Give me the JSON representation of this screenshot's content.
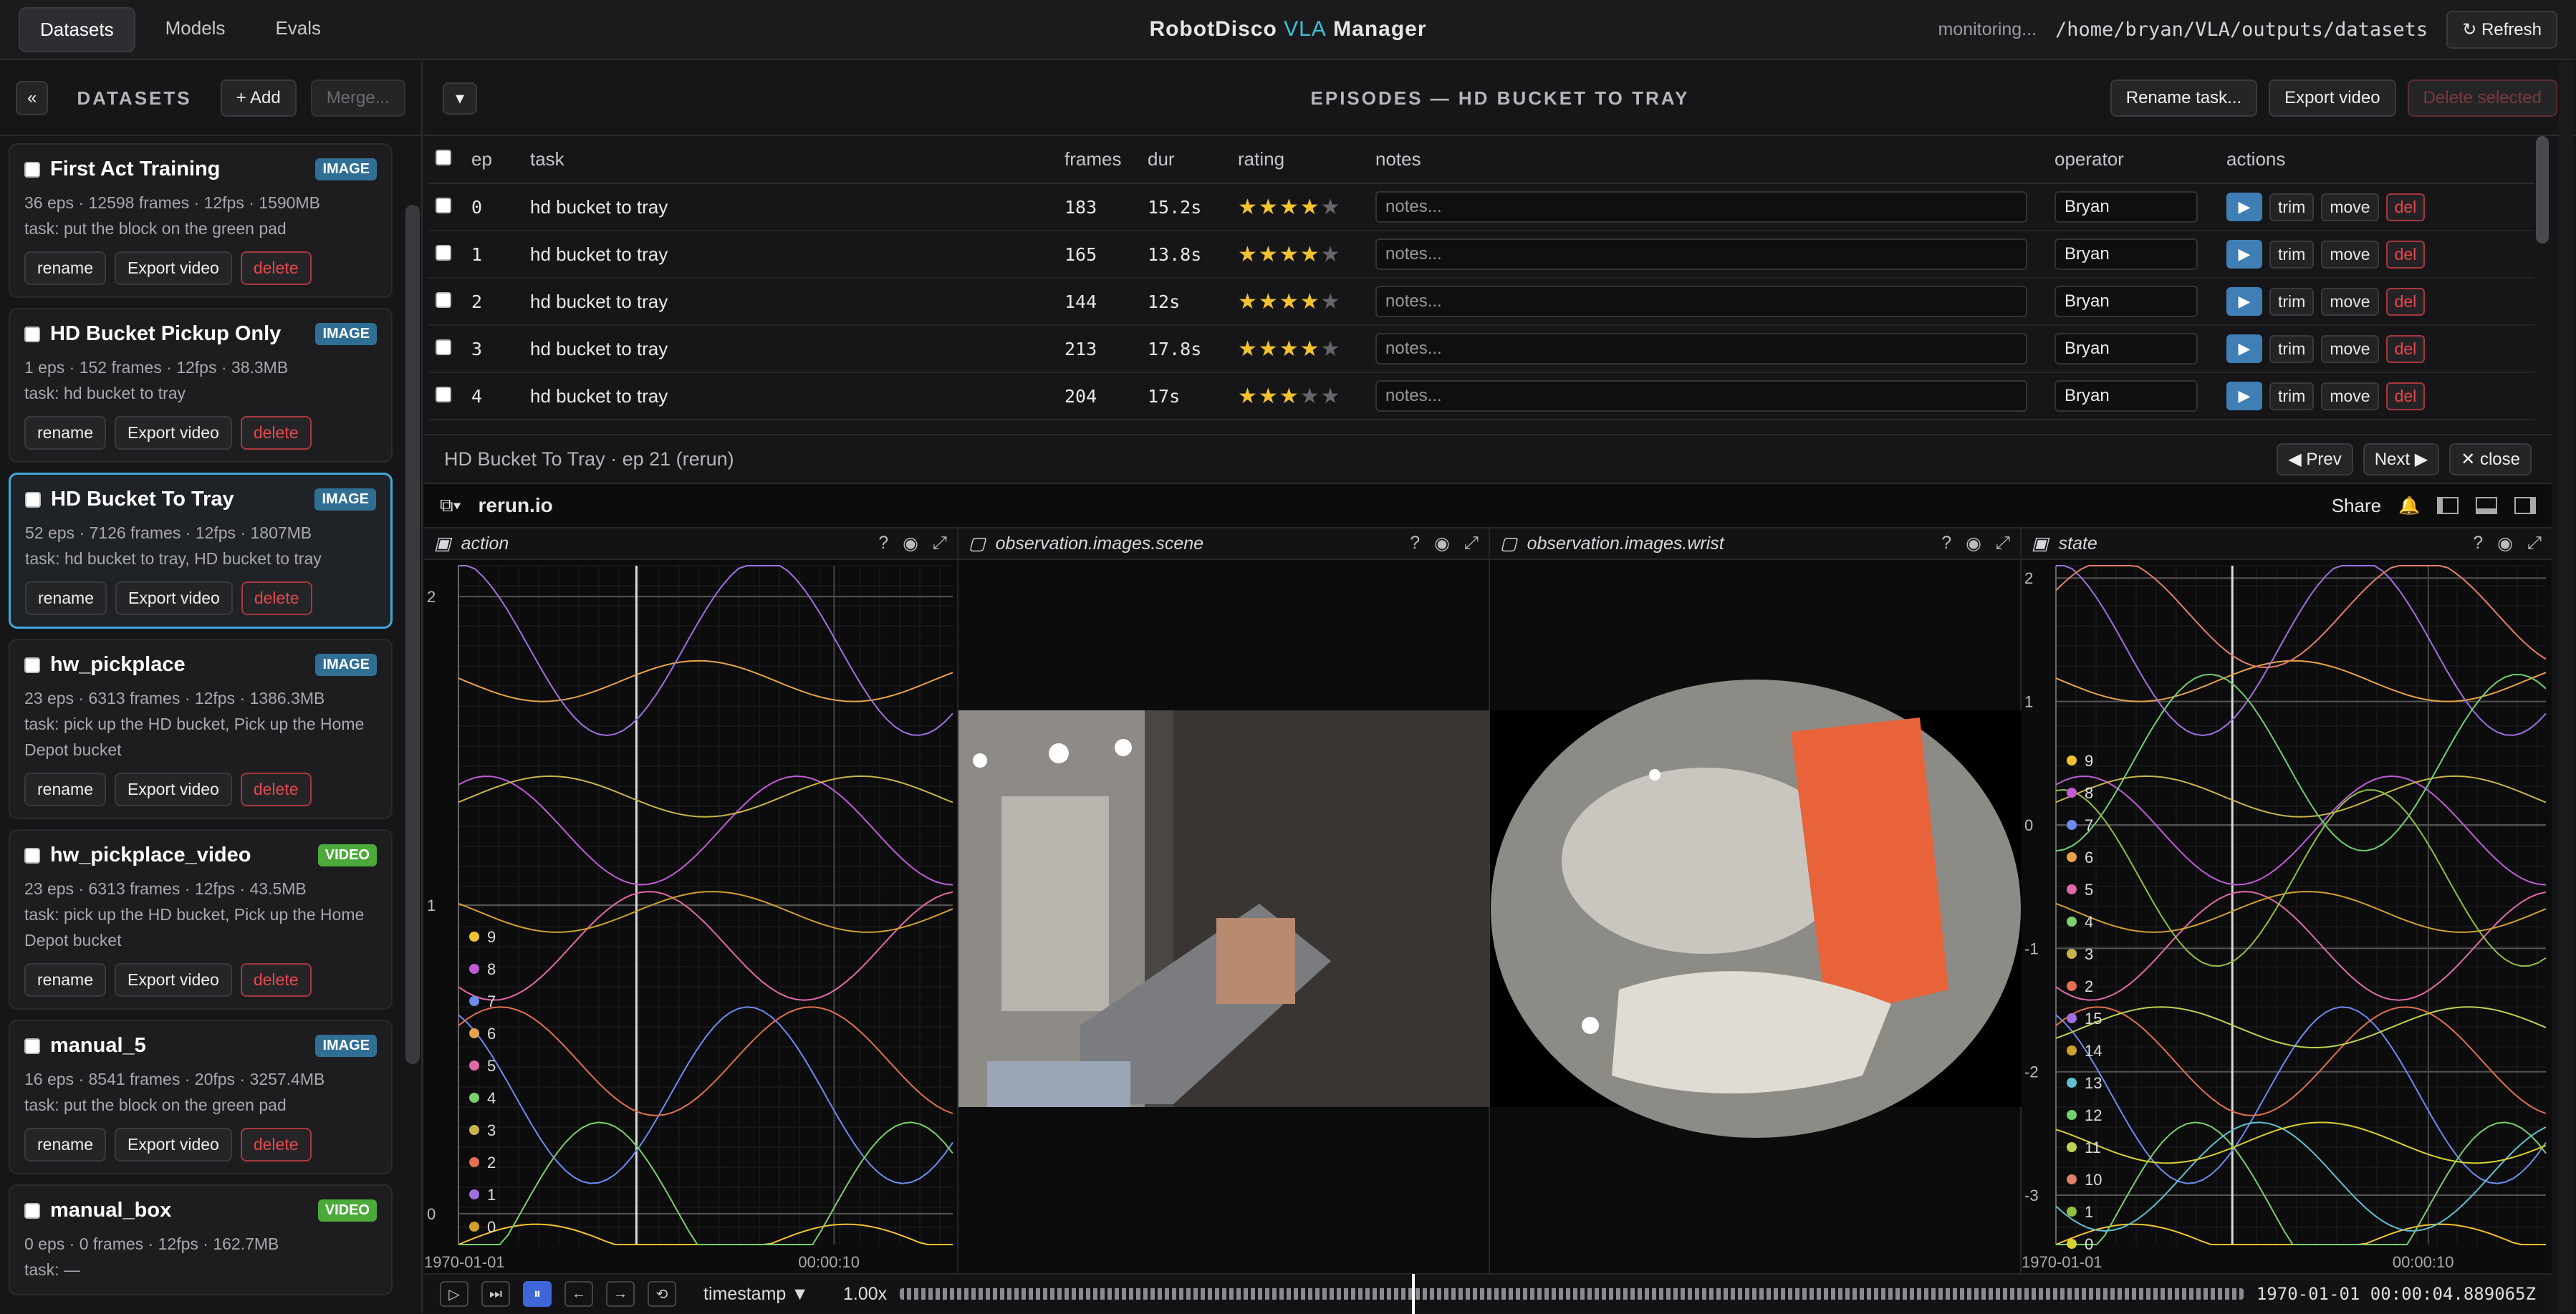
{
  "topbar": {
    "tabs": [
      "Datasets",
      "Models",
      "Evals"
    ],
    "title_a": "RobotDisco ",
    "title_b": "VLA",
    "title_c": " Manager",
    "monitoring": "monitoring...",
    "path": "/home/bryan/VLA/outputs/datasets",
    "refresh": "↻ Refresh"
  },
  "sidebar": {
    "collapse": "«",
    "label": "DATASETS",
    "add": "+ Add",
    "merge": "Merge...",
    "datasets": [
      {
        "name": "First Act Training",
        "badge": "IMAGE",
        "meta": "36 eps · 12598 frames · 12fps · 1590MB",
        "task": "task: put the block on the green pad"
      },
      {
        "name": "HD Bucket Pickup Only",
        "badge": "IMAGE",
        "meta": "1 eps · 152 frames · 12fps · 38.3MB",
        "task": "task: hd bucket to tray"
      },
      {
        "name": "HD Bucket To Tray",
        "badge": "IMAGE",
        "meta": "52 eps · 7126 frames · 12fps · 1807MB",
        "task": "task: hd bucket to tray, HD bucket to tray"
      },
      {
        "name": "hw_pickplace",
        "badge": "IMAGE",
        "meta": "23 eps · 6313 frames · 12fps · 1386.3MB",
        "task": "task: pick up the HD bucket, Pick up the Home Depot bucket"
      },
      {
        "name": "hw_pickplace_video",
        "badge": "VIDEO",
        "meta": "23 eps · 6313 frames · 12fps · 43.5MB",
        "task": "task: pick up the HD bucket, Pick up the Home Depot bucket"
      },
      {
        "name": "manual_5",
        "badge": "IMAGE",
        "meta": "16 eps · 8541 frames · 20fps · 3257.4MB",
        "task": "task: put the block on the green pad"
      },
      {
        "name": "manual_box",
        "badge": "VIDEO",
        "meta": "0 eps · 0 frames · 12fps · 162.7MB",
        "task": "task: —"
      }
    ],
    "rename": "rename",
    "export": "Export video",
    "delete": "delete"
  },
  "episodes": {
    "dropdown": "▾",
    "title": "EPISODES — HD BUCKET TO TRAY",
    "rename_task": "Rename task...",
    "export_video": "Export video",
    "delete_selected": "Delete selected",
    "columns": [
      "ep",
      "task",
      "frames",
      "dur",
      "rating",
      "notes",
      "operator",
      "actions"
    ],
    "rows": [
      {
        "ep": "0",
        "task": "hd bucket to tray",
        "frames": "183",
        "dur": "15.2s",
        "rating": 4,
        "notes": "notes...",
        "operator": "Bryan"
      },
      {
        "ep": "1",
        "task": "hd bucket to tray",
        "frames": "165",
        "dur": "13.8s",
        "rating": 4,
        "notes": "notes...",
        "operator": "Bryan"
      },
      {
        "ep": "2",
        "task": "hd bucket to tray",
        "frames": "144",
        "dur": "12s",
        "rating": 4,
        "notes": "notes...",
        "operator": "Bryan"
      },
      {
        "ep": "3",
        "task": "hd bucket to tray",
        "frames": "213",
        "dur": "17.8s",
        "rating": 4,
        "notes": "notes...",
        "operator": "Bryan"
      },
      {
        "ep": "4",
        "task": "hd bucket to tray",
        "frames": "204",
        "dur": "17s",
        "rating": 3,
        "notes": "notes...",
        "operator": "Bryan"
      }
    ],
    "row_actions": {
      "trim": "trim",
      "move": "move",
      "del": "del"
    }
  },
  "rerun": {
    "label": "HD Bucket To Tray · ep 21 (rerun)",
    "prev": "◀ Prev",
    "next": "Next ▶",
    "close": "✕ close",
    "app": "rerun.io",
    "share": "Share",
    "panels": [
      "action",
      "observation.images.scene",
      "observation.images.wrist",
      "state"
    ],
    "time_start": "1970-01-01",
    "time_mark": "00:00:10",
    "timeline_mode": "timestamp ▼",
    "speed": "1.00x",
    "timestamp": "1970-01-01 00:00:04.889065Z"
  },
  "chart_data": [
    {
      "type": "line",
      "title": "action",
      "ylim": [
        -0.1,
        2.1
      ],
      "yticks": [
        0,
        1,
        2
      ],
      "legend": [
        "9",
        "8",
        "7",
        "6",
        "5",
        "4",
        "3",
        "2",
        "1",
        "0"
      ]
    },
    {
      "type": "line",
      "title": "state",
      "ylim": [
        -3.4,
        2.1
      ],
      "yticks": [
        2,
        1,
        0,
        -1,
        -2,
        -3
      ],
      "legend": [
        "9",
        "8",
        "7",
        "6",
        "5",
        "4",
        "3",
        "2",
        "15",
        "14",
        "13",
        "12",
        "11",
        "10",
        "1",
        "0"
      ]
    }
  ]
}
